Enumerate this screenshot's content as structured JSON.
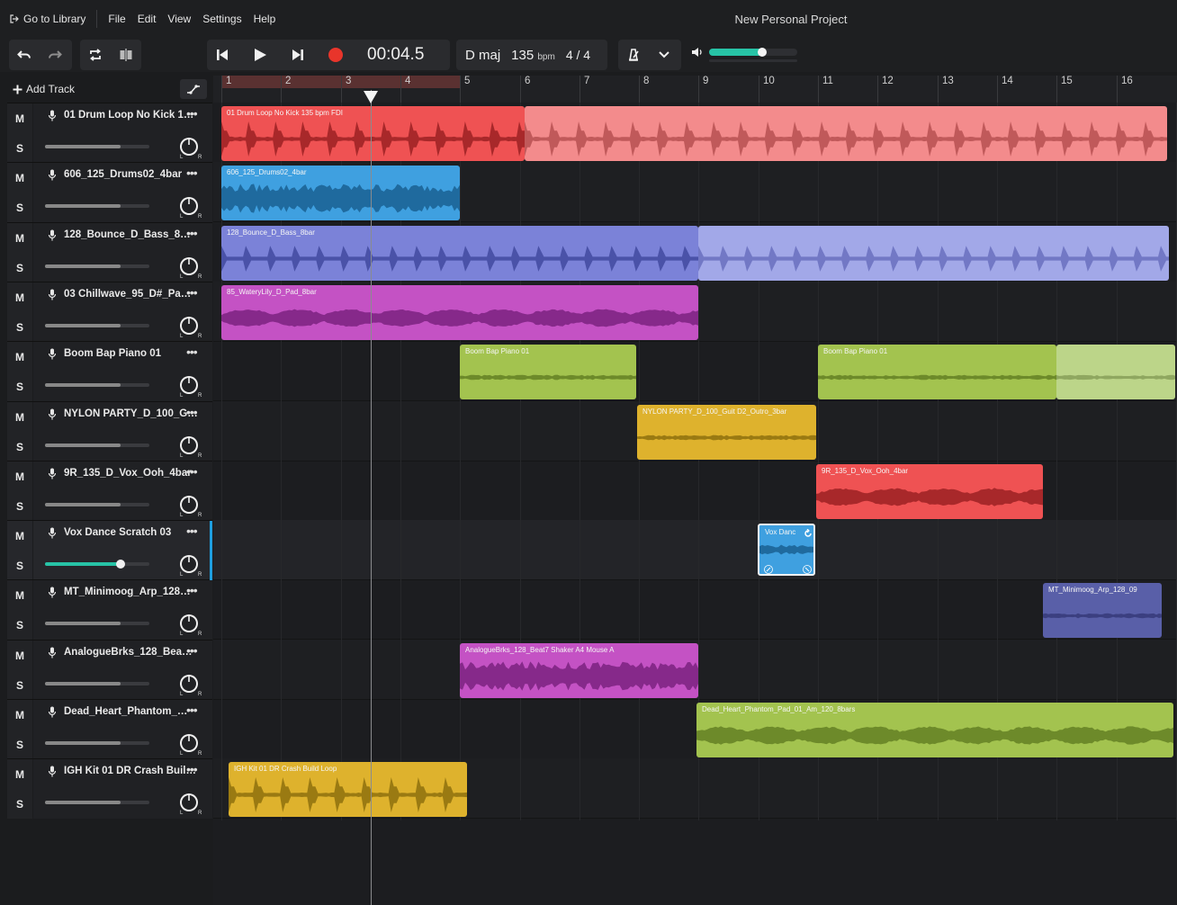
{
  "menubar": {
    "go_to_library": "Go to Library",
    "file": "File",
    "edit": "Edit",
    "view": "View",
    "settings": "Settings",
    "help": "Help",
    "project_title": "New Personal Project"
  },
  "transport": {
    "timecode": "00:04.5",
    "key": "D maj",
    "tempo": "135",
    "tempo_unit": "bpm",
    "time_signature": "4 / 4",
    "master_volume_fraction": 0.6
  },
  "sidebar": {
    "add_track": "Add Track"
  },
  "ruler": {
    "bars": [
      "1",
      "2",
      "3",
      "4",
      "5",
      "6",
      "7",
      "8",
      "9",
      "10",
      "11",
      "12",
      "13",
      "14",
      "15",
      "16"
    ]
  },
  "tracks": [
    {
      "name": "01 Drum Loop No Kick 1…",
      "mute": "M",
      "solo": "S",
      "volume": 0.72
    },
    {
      "name": "606_125_Drums02_4bar",
      "mute": "M",
      "solo": "S",
      "volume": 0.72
    },
    {
      "name": "128_Bounce_D_Bass_8…",
      "mute": "M",
      "solo": "S",
      "volume": 0.72
    },
    {
      "name": "03 Chillwave_95_D#_Pa…",
      "mute": "M",
      "solo": "S",
      "volume": 0.72
    },
    {
      "name": "Boom Bap Piano 01",
      "mute": "M",
      "solo": "S",
      "volume": 0.72
    },
    {
      "name": "NYLON PARTY_D_100_G…",
      "mute": "M",
      "solo": "S",
      "volume": 0.72
    },
    {
      "name": "9R_135_D_Vox_Ooh_4bar",
      "mute": "M",
      "solo": "S",
      "volume": 0.72
    },
    {
      "name": "Vox Dance Scratch 03",
      "mute": "M",
      "solo": "S",
      "volume": 0.72
    },
    {
      "name": "MT_Minimoog_Arp_128…",
      "mute": "M",
      "solo": "S",
      "volume": 0.72
    },
    {
      "name": "AnalogueBrks_128_Bea…",
      "mute": "M",
      "solo": "S",
      "volume": 0.72
    },
    {
      "name": "Dead_Heart_Phantom_…",
      "mute": "M",
      "solo": "S",
      "volume": 0.72
    },
    {
      "name": "IGH Kit 01 DR Crash Buil…",
      "mute": "M",
      "solo": "S",
      "volume": 0.72
    }
  ],
  "clips": {
    "drum_loop": "01 Drum Loop No Kick 135 bpm FDI",
    "drums606": "606_125_Drums02_4bar",
    "bass": "128_Bounce_D_Bass_8bar",
    "pad": "85_WateryLily_D_Pad_8bar",
    "piano_a": "Boom Bap Piano 01",
    "piano_b": "Boom Bap Piano 01",
    "nylon": "NYLON PARTY_D_100_Guit D2_Outro_3bar",
    "vox_ooh": "9R_135_D_Vox_Ooh_4bar",
    "vox_dance": "Vox Danc",
    "arp": "MT_Minimoog_Arp_128_09",
    "analogue": "AnalogueBrks_128_Beat7 Shaker A4 Mouse A",
    "dead_heart": "Dead_Heart_Phantom_Pad_01_Am_120_8bars",
    "crash": "IGH Kit 01 DR Crash Build Loop"
  },
  "colors": {
    "red": "#ef5253",
    "red_light": "#f38b8c",
    "blue": "#3fa0e0",
    "indigo": "#7b82d8",
    "indigo_light": "#a2a8e8",
    "magenta": "#c452c4",
    "lime": "#a3c34f",
    "lime_light": "#bcd589",
    "yellow": "#deb22d",
    "navy": "#595fa8",
    "accent_teal": "#27c3a6",
    "record_red": "#e8352b"
  }
}
